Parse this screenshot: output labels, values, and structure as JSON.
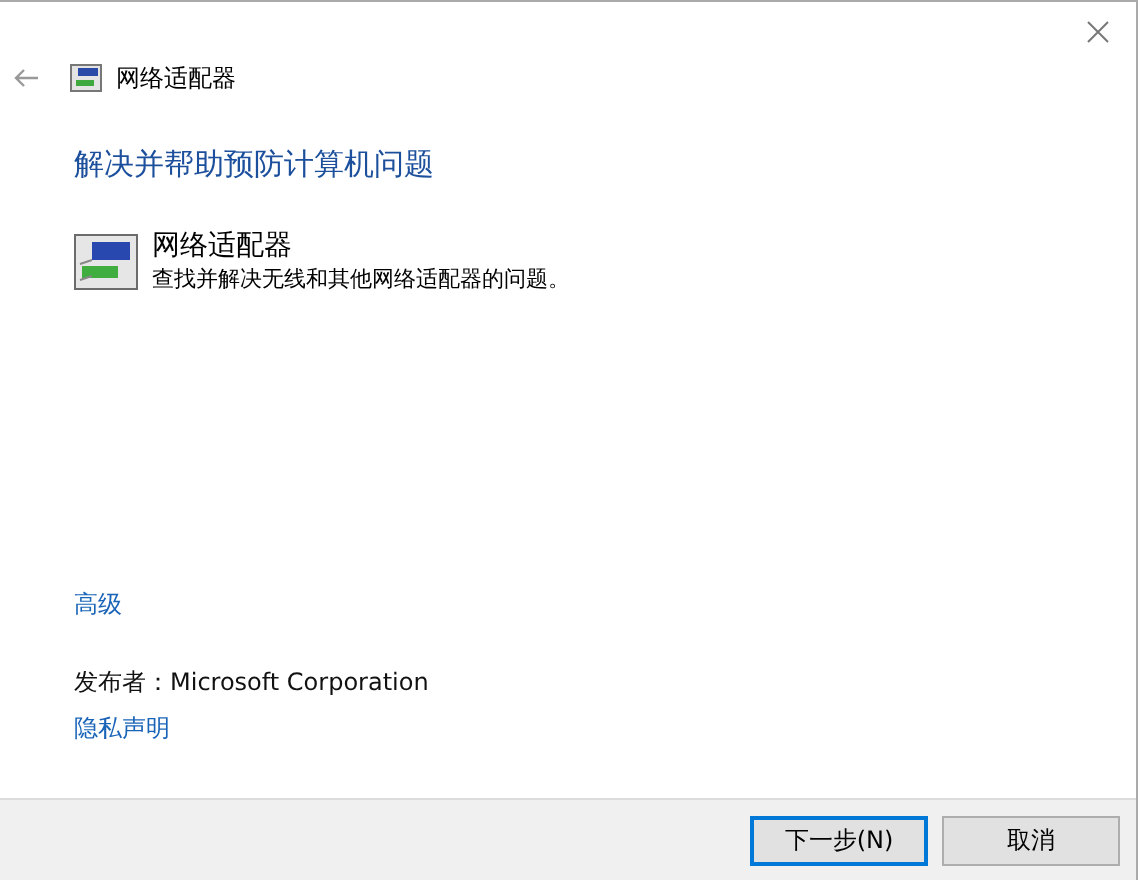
{
  "window": {
    "title": "网络适配器"
  },
  "heading": "解决并帮助预防计算机问题",
  "troubleshooter": {
    "name": "网络适配器",
    "description": "查找并解决无线和其他网络适配器的问题。"
  },
  "advanced_link": "高级",
  "publisher": "发布者：Microsoft Corporation",
  "privacy_link": "隐私声明",
  "buttons": [
    {
      "label": "下一步(N)",
      "kind": "primary"
    },
    {
      "label": "取消",
      "kind": "secondary"
    }
  ]
}
